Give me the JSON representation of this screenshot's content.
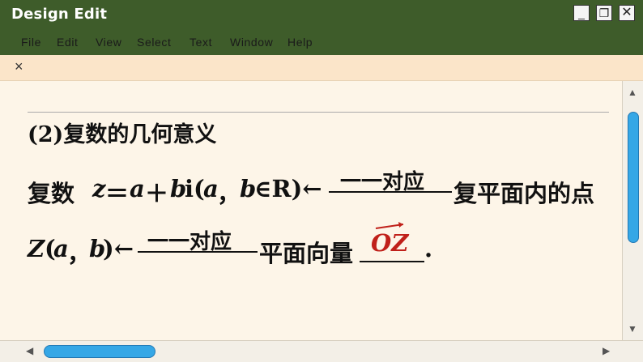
{
  "window": {
    "title": "Design Edit",
    "minimize_glyph": "_",
    "maximize_glyph": "❐",
    "close_glyph": "✕"
  },
  "menu": [
    "File",
    "Edit",
    "View",
    "Select",
    "Text",
    "Window",
    "Help"
  ],
  "tab": {
    "close_glyph": "×"
  },
  "slide": {
    "heading": "(2)复数的几何意义",
    "line1": {
      "prefix": "复数",
      "z": "z",
      "eq": "＝",
      "a": "a",
      "plus": "＋",
      "b": "b",
      "i_paren": "i(",
      "a2": "a",
      "comma": "，",
      "b2": "b",
      "in_R": "∈R)←",
      "arrow_label": "一一对应",
      "suffix": "复平面内的点"
    },
    "line2": {
      "Z": "Z",
      "open": "(",
      "a": "a",
      "comma": "，",
      "b": "b",
      "close_arrow": ")←",
      "arrow_label": "一一对应",
      "middle": "平面向量",
      "vector_label": "OZ",
      "period": "."
    }
  },
  "scrollbars": {
    "up": "▲",
    "down": "▼",
    "left": "◀",
    "right": "▶"
  },
  "colors": {
    "titlebar": "#3E5C2A",
    "tabbar": "#FBE5C9",
    "canvas": "#FDF5E8",
    "scroll_thumb": "#35A7E6",
    "vector": "#C0201A"
  }
}
